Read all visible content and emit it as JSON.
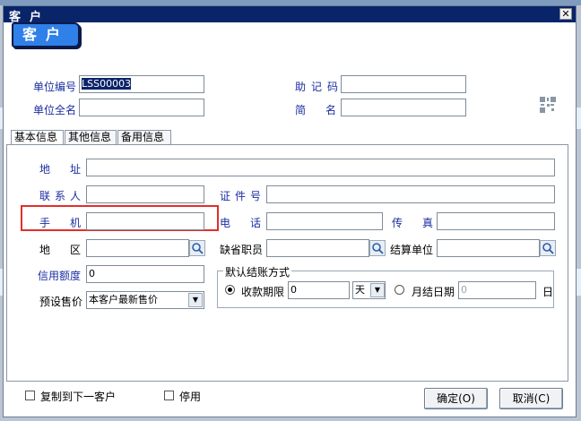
{
  "window": {
    "title": "客户",
    "close_label": "✕",
    "badge": "客户"
  },
  "header_fields": {
    "unit_code_label": "单位编号",
    "unit_code_value": "LSS00003",
    "full_name_label": "单位全名",
    "full_name_value": "",
    "mnemonic_label": "助记码",
    "mnemonic_value": "",
    "short_name_label": "简名",
    "short_name_value": ""
  },
  "tabs": [
    "基本信息",
    "其他信息",
    "备用信息"
  ],
  "basic": {
    "address_label": "地址",
    "address_value": "",
    "contact_label": "联系人",
    "contact_value": "",
    "id_label": "证件号",
    "id_value": "",
    "mobile_label": "手机",
    "mobile_value": "",
    "phone_label": "电话",
    "phone_value": "",
    "fax_label": "传真",
    "fax_value": "",
    "region_label": "地区",
    "region_value": "",
    "staff_label": "缺省职员",
    "staff_value": "",
    "settle_unit_label": "结算单位",
    "settle_unit_value": "",
    "credit_label": "信用额度",
    "credit_value": "0",
    "price_label": "预设售价",
    "price_value": "本客户最新售价"
  },
  "settlement": {
    "title": "默认结账方式",
    "term_label": "收款期限",
    "term_value": "0",
    "term_unit": "天",
    "monthly_label": "月结日期",
    "monthly_value": "0",
    "day_suffix": "日",
    "selected": "term"
  },
  "footer": {
    "copy_next_label": "复制到下一客户",
    "disable_label": "停用",
    "ok_label": "确定(O)",
    "cancel_label": "取消(C)"
  },
  "colors": {
    "title_bar": "#0a246a",
    "badge": "#2f80e8",
    "label_blue": "#1a2ea0",
    "highlight_box": "#e0302a"
  }
}
